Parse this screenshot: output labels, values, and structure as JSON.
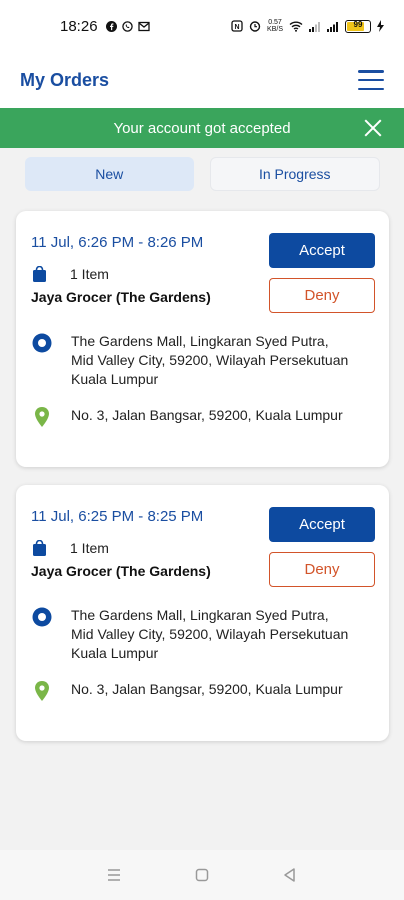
{
  "status_bar": {
    "time": "18:26",
    "notification_icons": [
      "facebook-icon",
      "whatsapp-icon",
      "mail-icon"
    ],
    "network_speed": "0.57\nKB/S",
    "battery_level": "99"
  },
  "app_bar": {
    "title": "My Orders"
  },
  "banner": {
    "message": "Your account got accepted",
    "color": "#3aa55c"
  },
  "tabs": [
    {
      "label": "New",
      "active": true
    },
    {
      "label": "In Progress",
      "active": false
    }
  ],
  "orders": [
    {
      "time_window": "11 Jul, 6:26 PM - 8:26 PM",
      "item_count": "1 Item",
      "store": "Jaya Grocer (The Gardens)",
      "pickup_address": "The Gardens Mall, Lingkaran Syed Putra, Mid Valley City, 59200, Wilayah Persekutuan Kuala Lumpur",
      "dropoff_address": "No. 3, Jalan Bangsar, 59200, Kuala Lumpur",
      "accept_label": "Accept",
      "deny_label": "Deny"
    },
    {
      "time_window": "11 Jul, 6:25 PM - 8:25 PM",
      "item_count": "1 Item",
      "store": "Jaya Grocer (The Gardens)",
      "pickup_address": "The Gardens Mall, Lingkaran Syed Putra, Mid Valley City, 59200, Wilayah Persekutuan Kuala Lumpur",
      "dropoff_address": "No. 3, Jalan Bangsar, 59200, Kuala Lumpur",
      "accept_label": "Accept",
      "deny_label": "Deny"
    }
  ],
  "colors": {
    "brand_blue": "#1a4ea1",
    "accept_button": "#0d4aa0",
    "deny_button": "#d2542a",
    "pickup_marker": "#0d4aa0",
    "dropoff_marker": "#7ab648"
  },
  "nav_bar": {
    "buttons": [
      "menu-nav-icon",
      "home-square-icon",
      "back-triangle-icon"
    ]
  }
}
